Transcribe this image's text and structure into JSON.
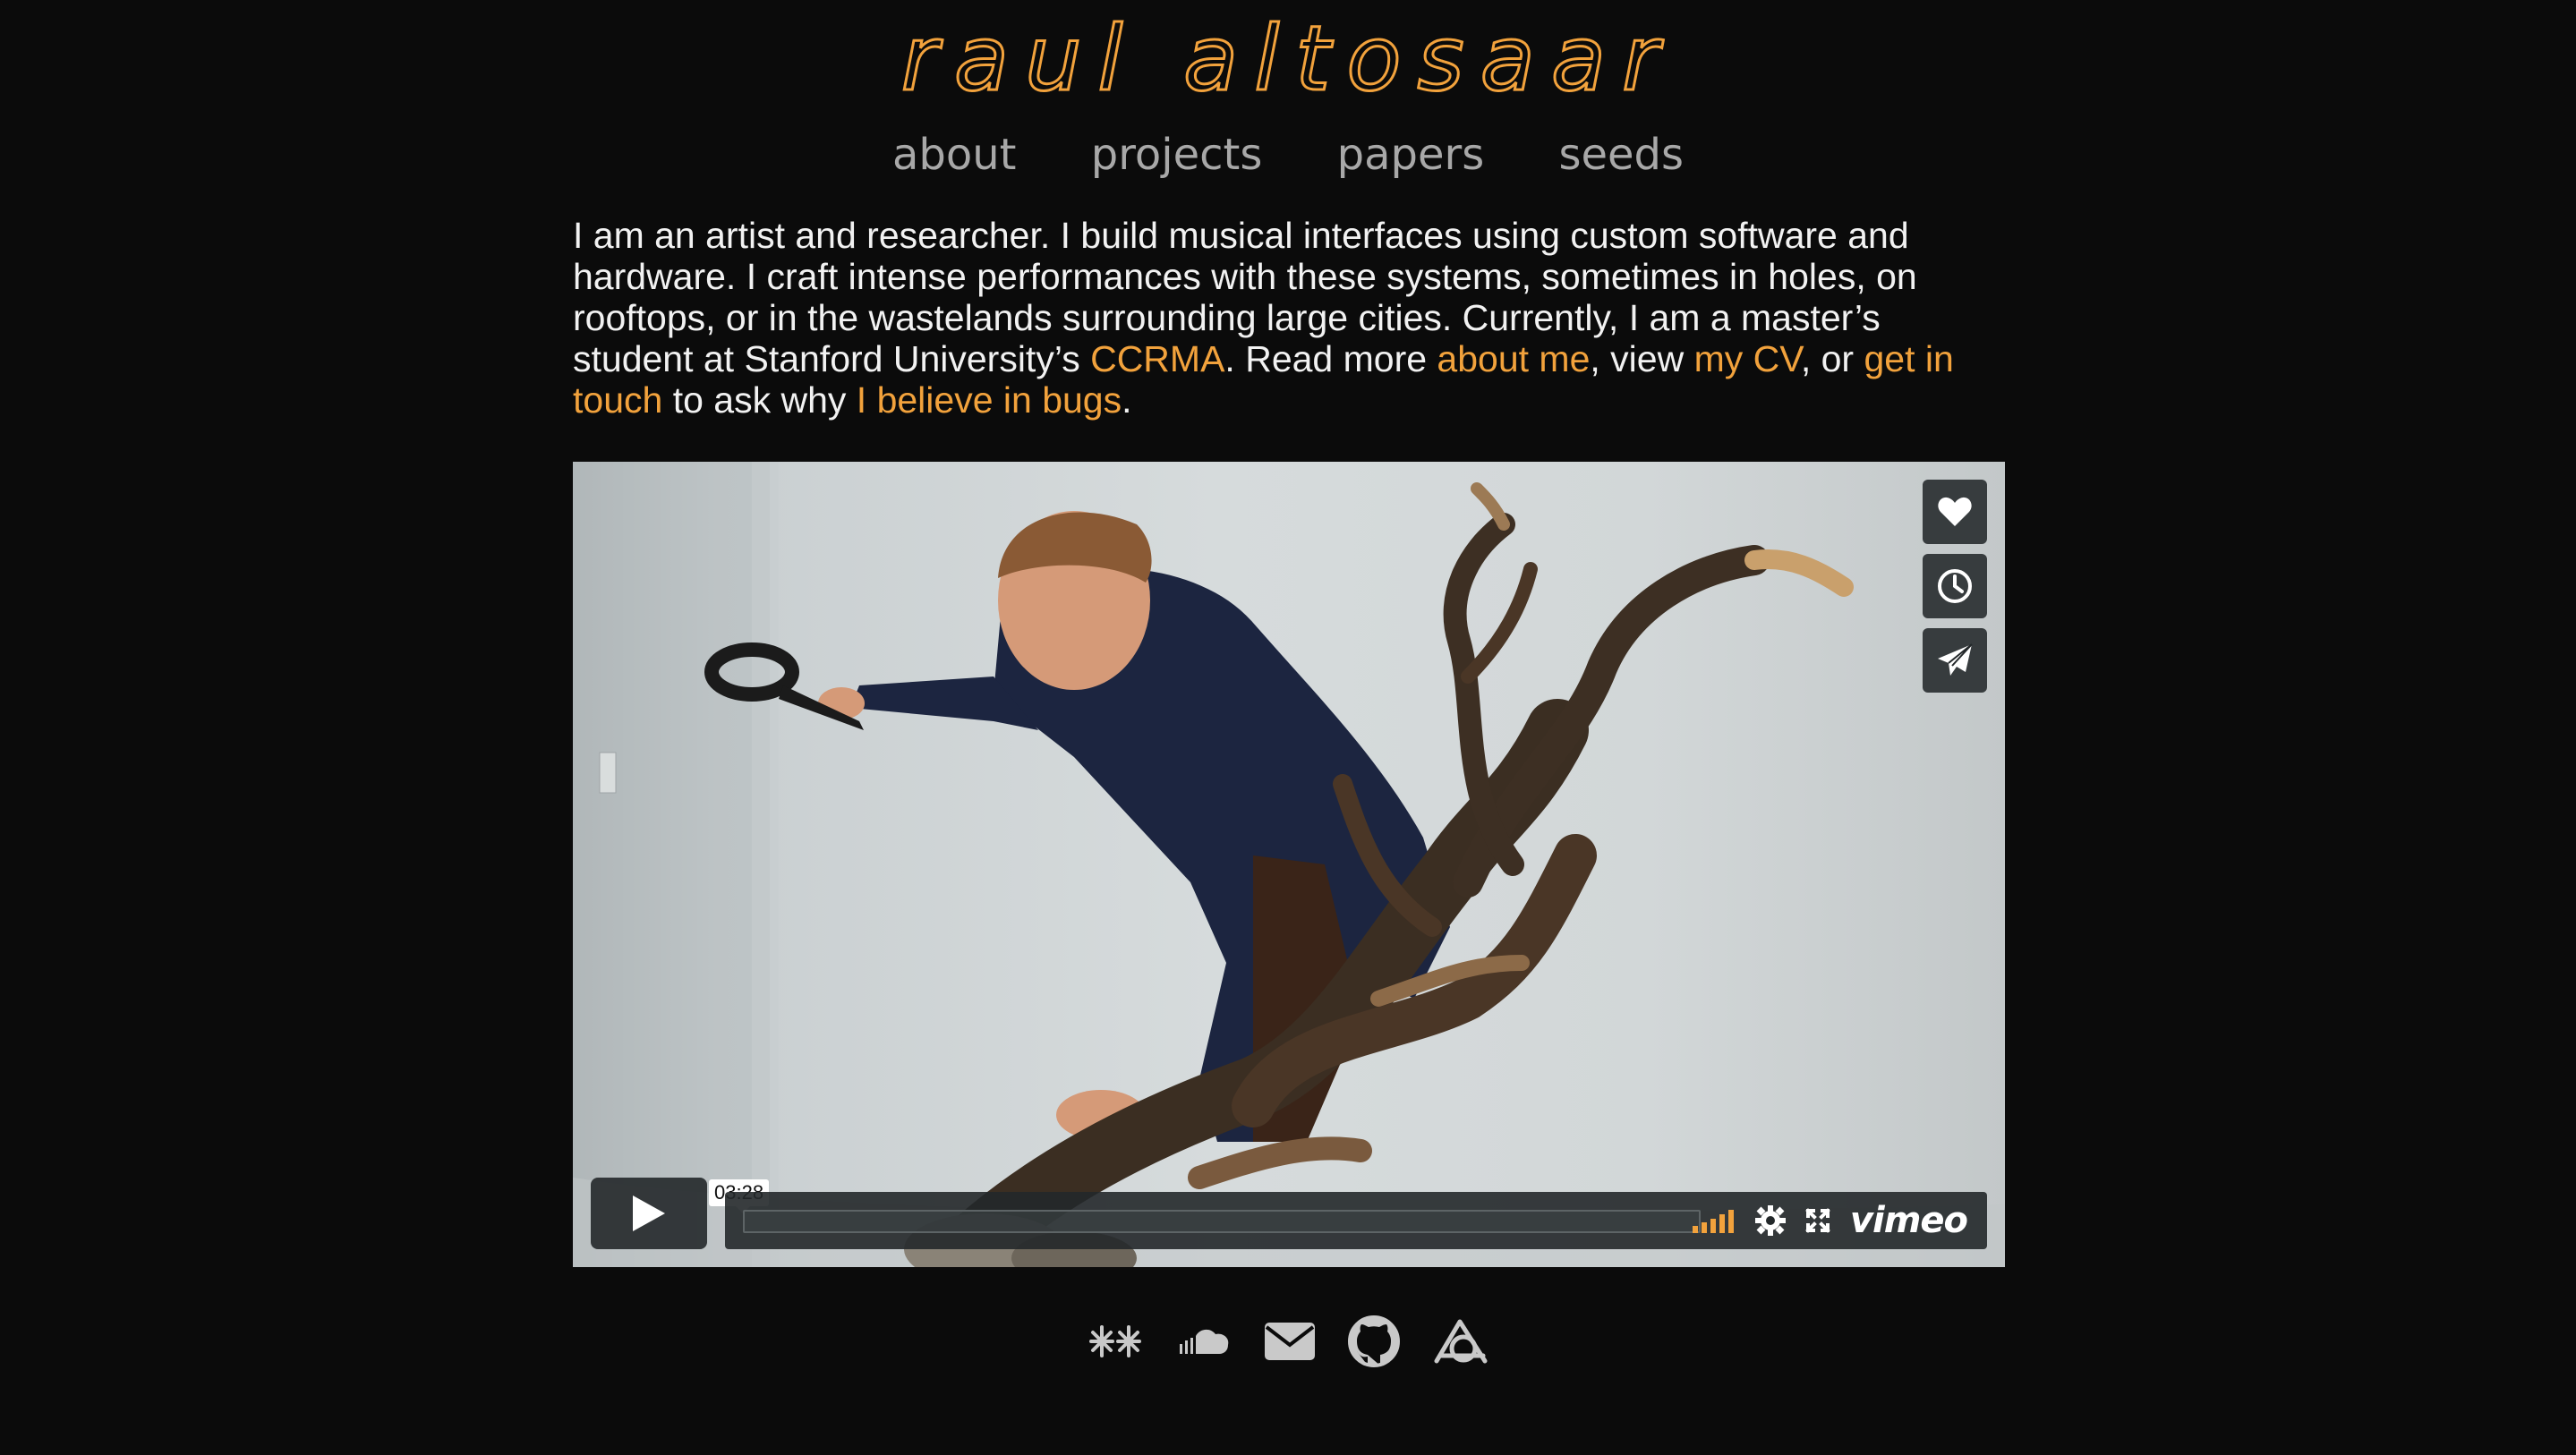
{
  "site": {
    "title": "raul altosaar"
  },
  "nav": {
    "items": [
      {
        "label": "about"
      },
      {
        "label": "projects"
      },
      {
        "label": "papers"
      },
      {
        "label": "seeds"
      }
    ]
  },
  "intro": {
    "part1": "I am an artist and researcher. I build musical interfaces using custom software and hardware. I craft intense performances with these systems, sometimes in holes, on rooftops, or in the wastelands surrounding large cities. Currently, I am a master’s student at Stanford University’s ",
    "link_ccrma": "CCRMA",
    "part2": ". Read more ",
    "link_about": "about me",
    "part3": ", view ",
    "link_cv": "my CV",
    "part4": ", or ",
    "link_contact": "get in touch",
    "part5": " to ask why ",
    "link_bugs": "I believe in bugs",
    "part6": "."
  },
  "video": {
    "duration": "03:28",
    "brand": "vimeo",
    "side_buttons": [
      "heart-icon",
      "clock-icon",
      "send-icon"
    ]
  },
  "footer": {
    "icons": [
      "star-icon",
      "soundcloud-icon",
      "mail-icon",
      "github-icon",
      "arena-icon"
    ]
  },
  "colors": {
    "background": "#0b0b0b",
    "accent": "#f2a23c",
    "nav": "#a8a8a8",
    "text": "#f2f2f2"
  }
}
